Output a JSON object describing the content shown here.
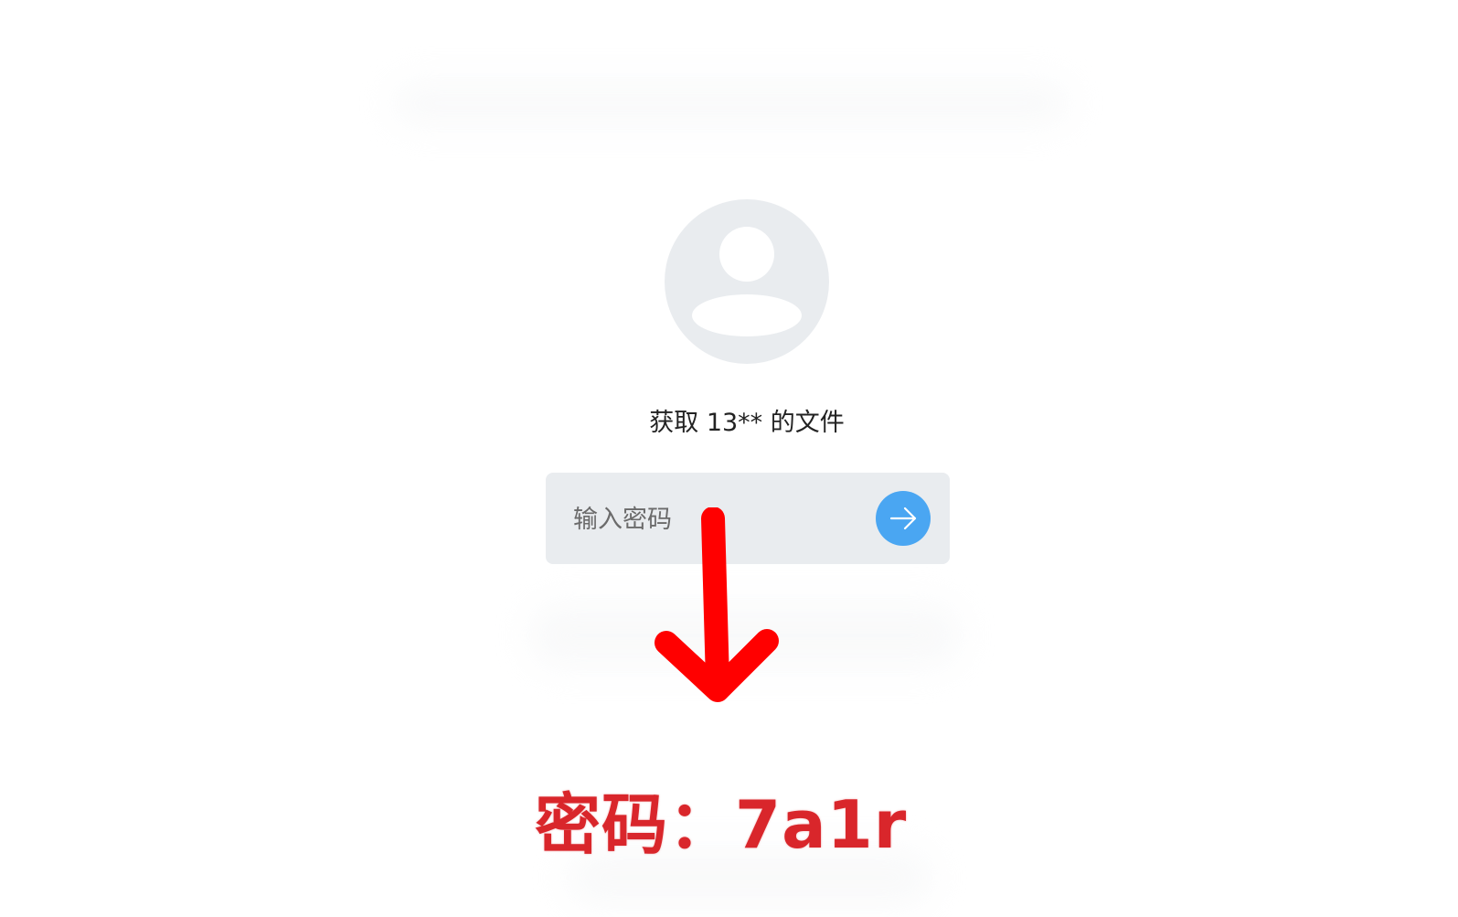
{
  "share": {
    "caption": "获取 13** 的文件",
    "password_placeholder": "输入密码",
    "submit_icon": "arrow-right-icon"
  },
  "annotation": {
    "arrow_icon": "red-down-arrow",
    "password_text": "密码：7a1r"
  },
  "colors": {
    "background": "#ffffff",
    "input_bg": "#e9ecef",
    "button": "#4aa6f2",
    "annotation_red": "#d9262b"
  }
}
